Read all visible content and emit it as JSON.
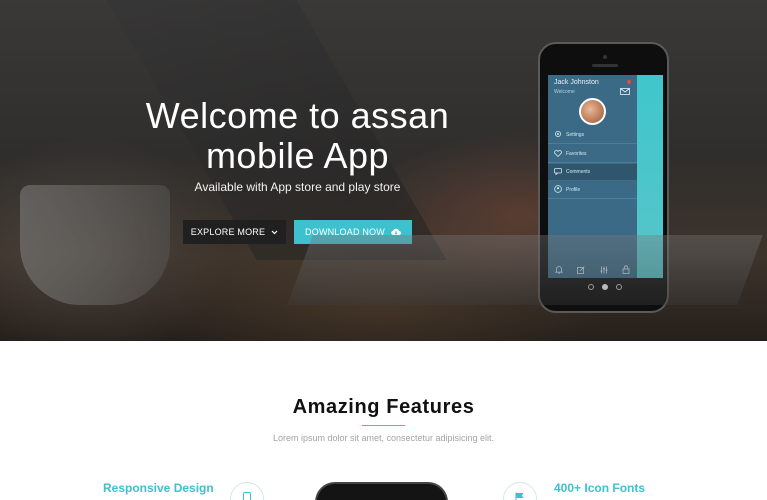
{
  "hero": {
    "title_line1": "Welcome to assan",
    "title_line2": "mobile App",
    "subtitle": "Available with App store and play store",
    "explore_label": "EXPLORE MORE",
    "download_label": "DOWNLOAD NOW"
  },
  "phone": {
    "user_name": "Jack Johnston",
    "greeting": "Welcome",
    "menu": [
      {
        "label": "Settings",
        "icon": "gear-icon"
      },
      {
        "label": "Favorites",
        "icon": "heart-icon"
      },
      {
        "label": "Comments",
        "icon": "comment-icon"
      },
      {
        "label": "Profile",
        "icon": "user-icon"
      }
    ],
    "active_menu_index": 2,
    "bottom_icons": [
      "bell-icon",
      "edit-icon",
      "sliders-icon",
      "lock-icon"
    ],
    "carousel_active": 1,
    "carousel_count": 3
  },
  "features": {
    "title": "Amazing Features",
    "subtitle": "Lorem ipsum dolor sit amet, consectetur adipisicing elit.",
    "left_title": "Responsive Design",
    "right_title": "400+ Icon Fonts"
  },
  "colors": {
    "accent": "#3ec1cf",
    "dark_button": "#202020",
    "drawer": "#3a6a86"
  }
}
